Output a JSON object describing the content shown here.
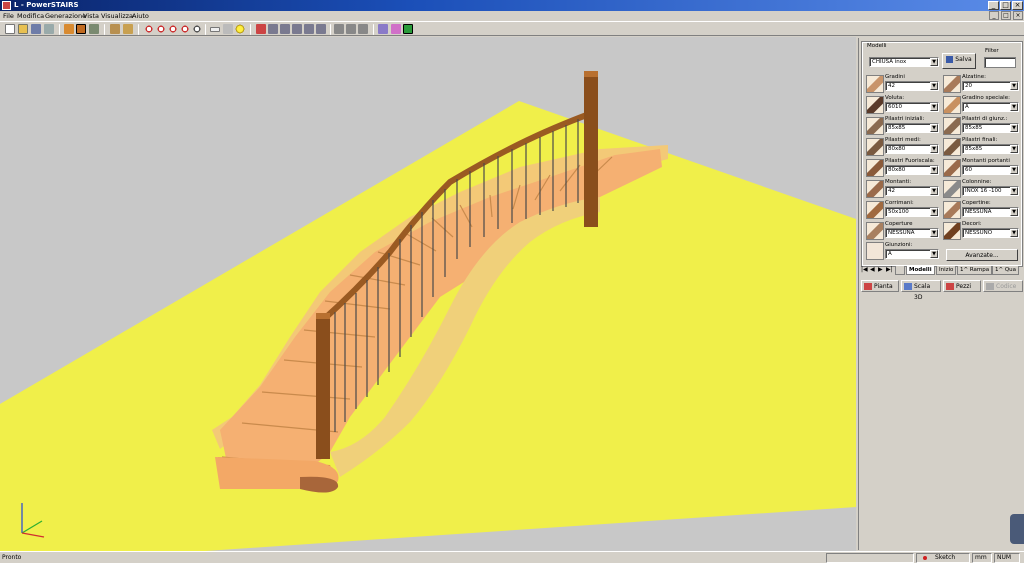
{
  "window": {
    "title": "L - PowerSTAIRS",
    "min": "_",
    "max": "□",
    "close": "×"
  },
  "menu": [
    "File",
    "Modifica",
    "Generazione",
    "Vista",
    "Visualizza",
    "Aiuto"
  ],
  "mdi_buttons": {
    "min": "_",
    "restore": "□",
    "close": "×"
  },
  "panel": {
    "modelli_label": "Modelli",
    "modelli_value": "CHIUSA inox",
    "salva_label": "Salva",
    "filter_label": "Filter",
    "filter_value": "",
    "fields": [
      {
        "label": "Gradini",
        "value": "42"
      },
      {
        "label": "Alzatine:",
        "value": "20"
      },
      {
        "label": "Voluta:",
        "value": "6010"
      },
      {
        "label": "Gradino speciale:",
        "value": "A"
      },
      {
        "label": "Pilastri iniziali:",
        "value": "85x85"
      },
      {
        "label": "Pilastri di giunz.:",
        "value": "85x85"
      },
      {
        "label": "Pilastri medi:",
        "value": "80x80"
      },
      {
        "label": "Pilastri finali:",
        "value": "85x85"
      },
      {
        "label": "Pilastri Fuoriscala:",
        "value": "80x80"
      },
      {
        "label": "Montanti portanti",
        "value": "60"
      },
      {
        "label": "Montanti:",
        "value": "42"
      },
      {
        "label": "Colonnine:",
        "value": "INOX 16 -100"
      },
      {
        "label": "Corrimani:",
        "value": "50x100"
      },
      {
        "label": "Copertine:",
        "value": "NESSUNA"
      },
      {
        "label": "Coperture",
        "value": "NESSUNA"
      },
      {
        "label": "Decori:",
        "value": "NESSUNO"
      }
    ],
    "giunzioni_label": "Giunzioni:",
    "giunzioni_value": "A",
    "avanzate_label": "Avanzate...",
    "tabs": [
      "Modelli",
      "Inizio",
      "1^ Rampa",
      "1^ Qua"
    ],
    "view_tabs": [
      "Pianta",
      "Scala 3D",
      "Pezzi",
      "Codice"
    ]
  },
  "status": {
    "left": "Pronto",
    "sketch": "Sketch",
    "unit": "mm",
    "num": "NUM"
  },
  "colors": {
    "floor": "#f0ef4a",
    "steps": "#f5b072",
    "wood": "#9a5a22",
    "viewport_bg": "#c8c8c8"
  }
}
